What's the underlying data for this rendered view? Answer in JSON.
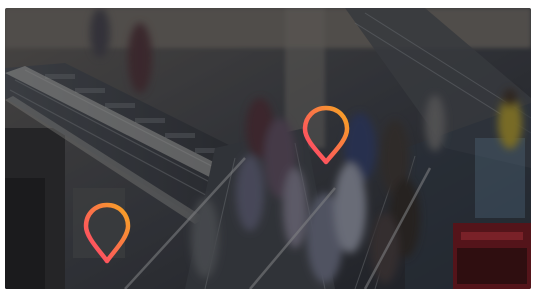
{
  "scene": {
    "description_label": "",
    "overlay_tint": "#000000",
    "pin_gradient": {
      "start": "#ff3d6e",
      "end": "#f6a623"
    }
  },
  "pins": [
    {
      "name": "location-pin-icon"
    },
    {
      "name": "location-pin-icon"
    }
  ],
  "signage": {
    "text": ""
  }
}
